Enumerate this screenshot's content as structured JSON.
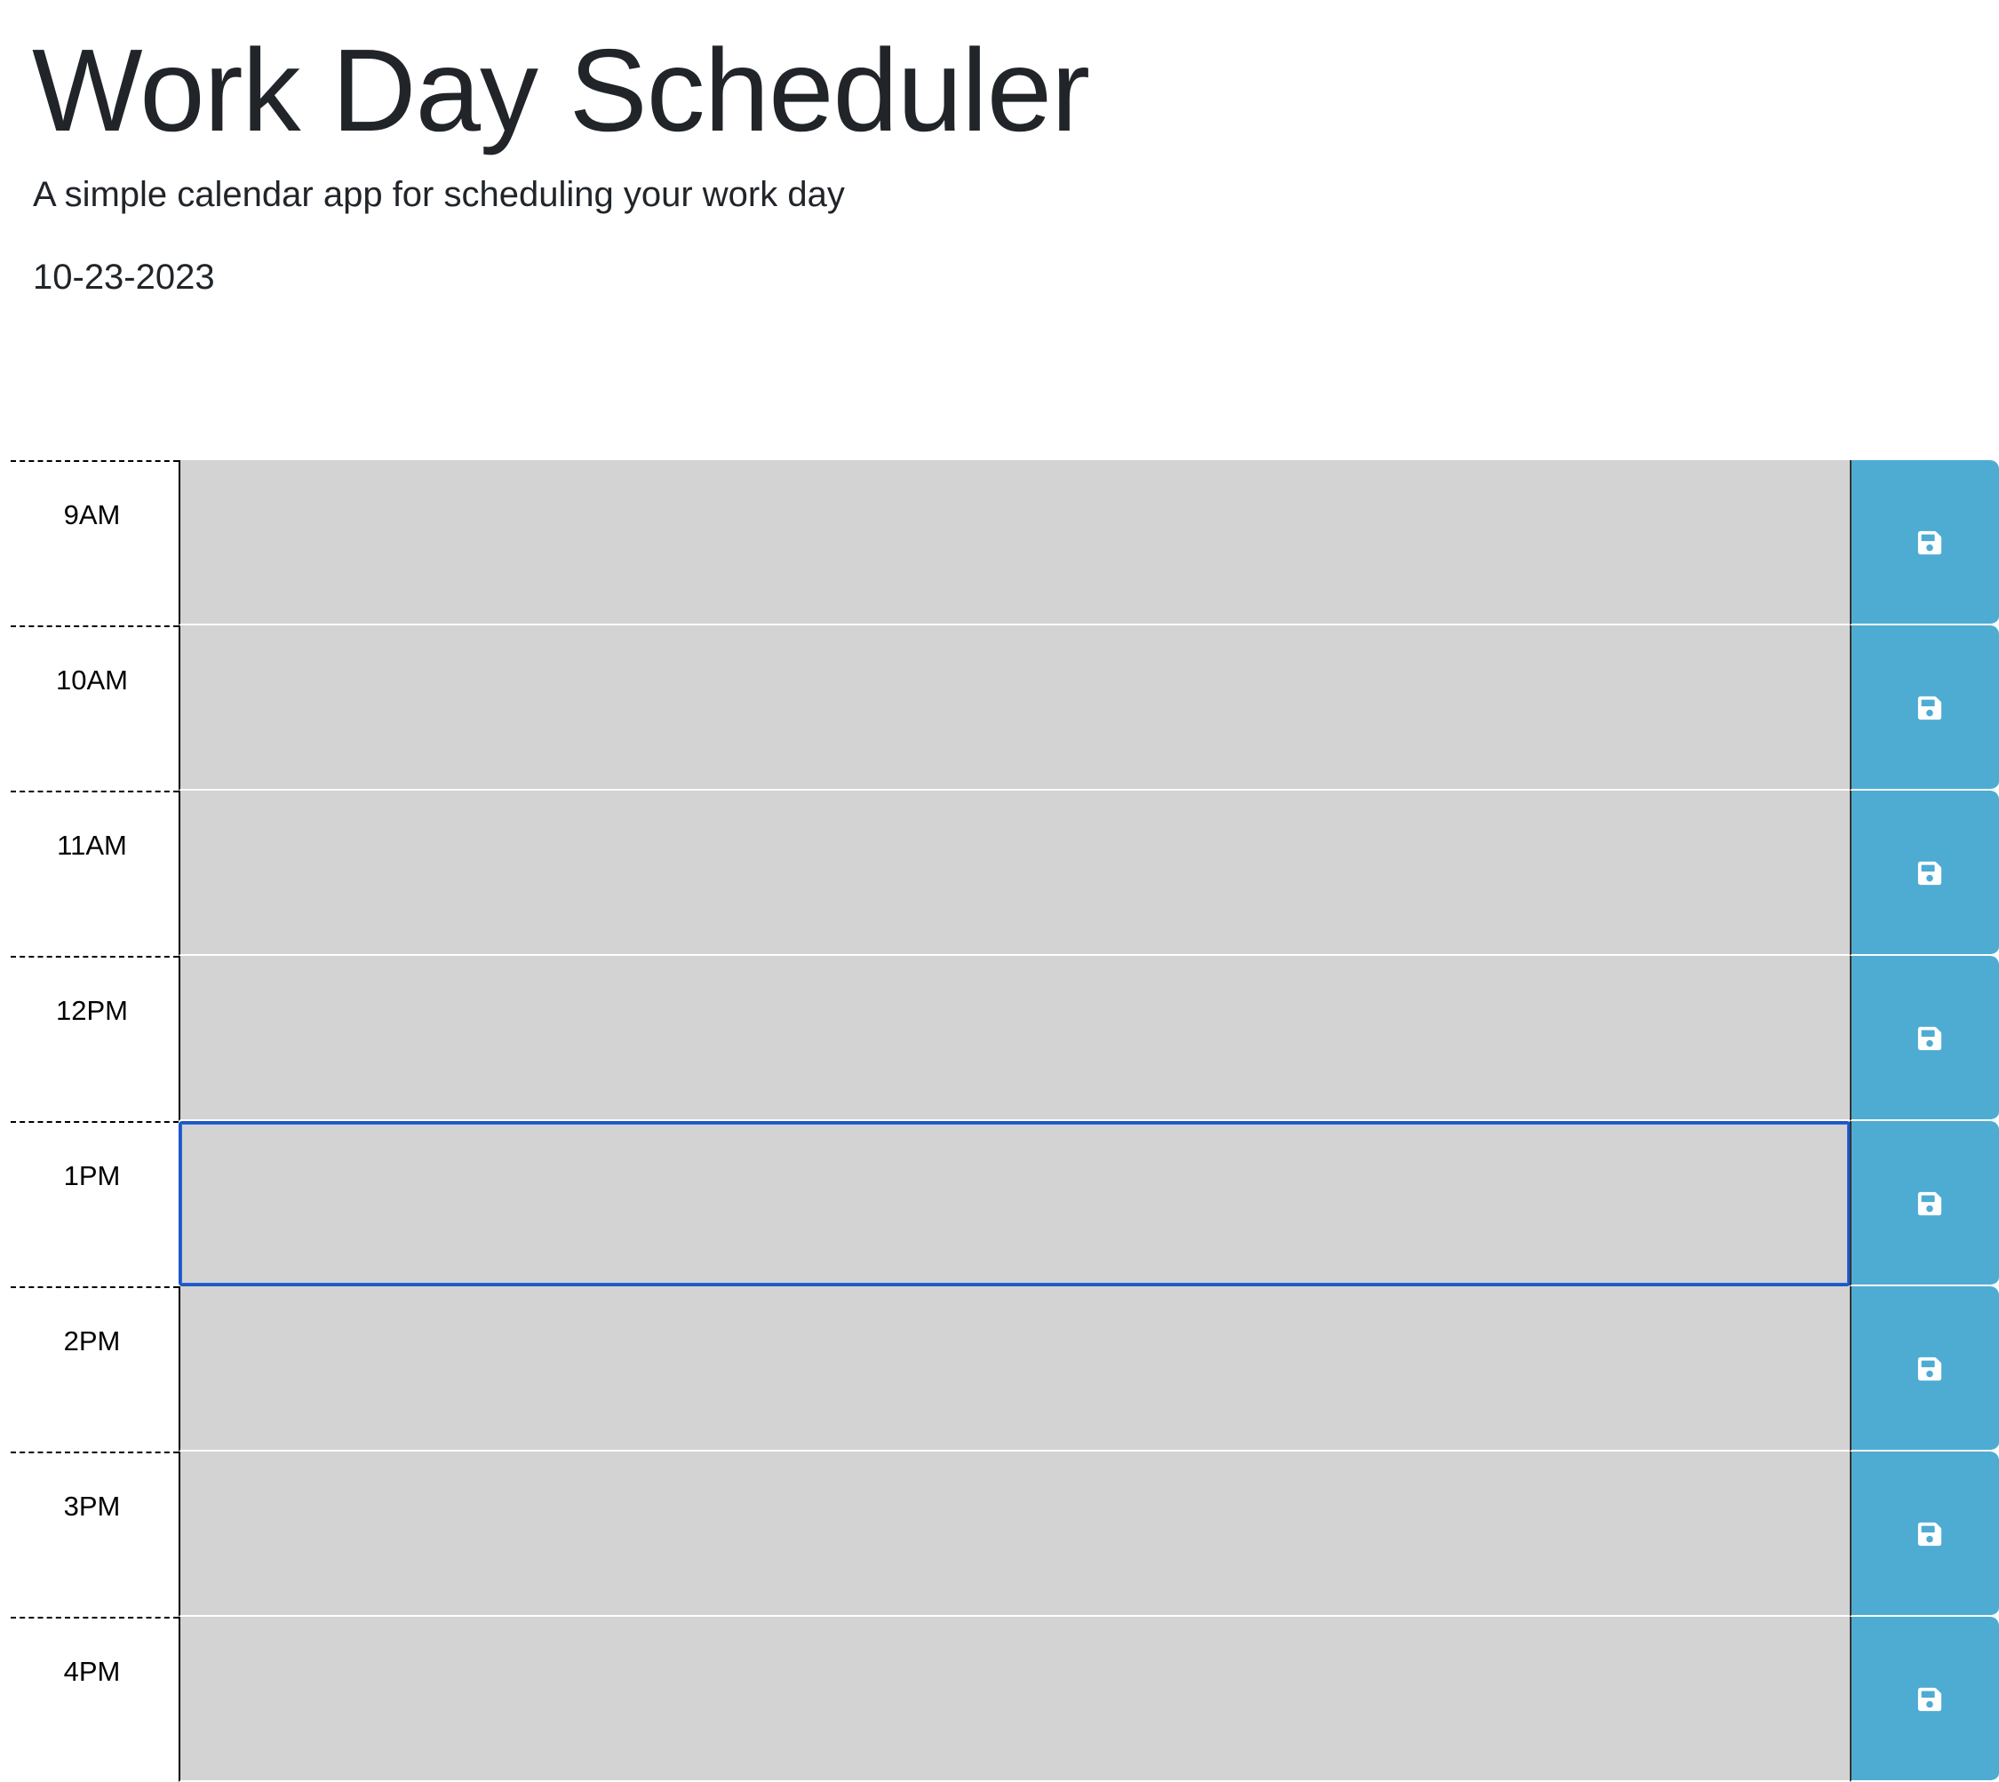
{
  "header": {
    "title": "Work Day Scheduler",
    "subtitle": "A simple calendar app for scheduling your work day",
    "current_date": "10-23-2023"
  },
  "colors": {
    "time_block_background": "#d3d3d3",
    "save_button": "#4eacd3",
    "focused_border": "#1d56c6"
  },
  "schedule": {
    "focused_hour": "1PM",
    "save_icon": "floppy-disk-icon",
    "rows": [
      {
        "hour": "9AM",
        "description": ""
      },
      {
        "hour": "10AM",
        "description": ""
      },
      {
        "hour": "11AM",
        "description": ""
      },
      {
        "hour": "12PM",
        "description": ""
      },
      {
        "hour": "1PM",
        "description": ""
      },
      {
        "hour": "2PM",
        "description": ""
      },
      {
        "hour": "3PM",
        "description": ""
      },
      {
        "hour": "4PM",
        "description": ""
      }
    ]
  }
}
